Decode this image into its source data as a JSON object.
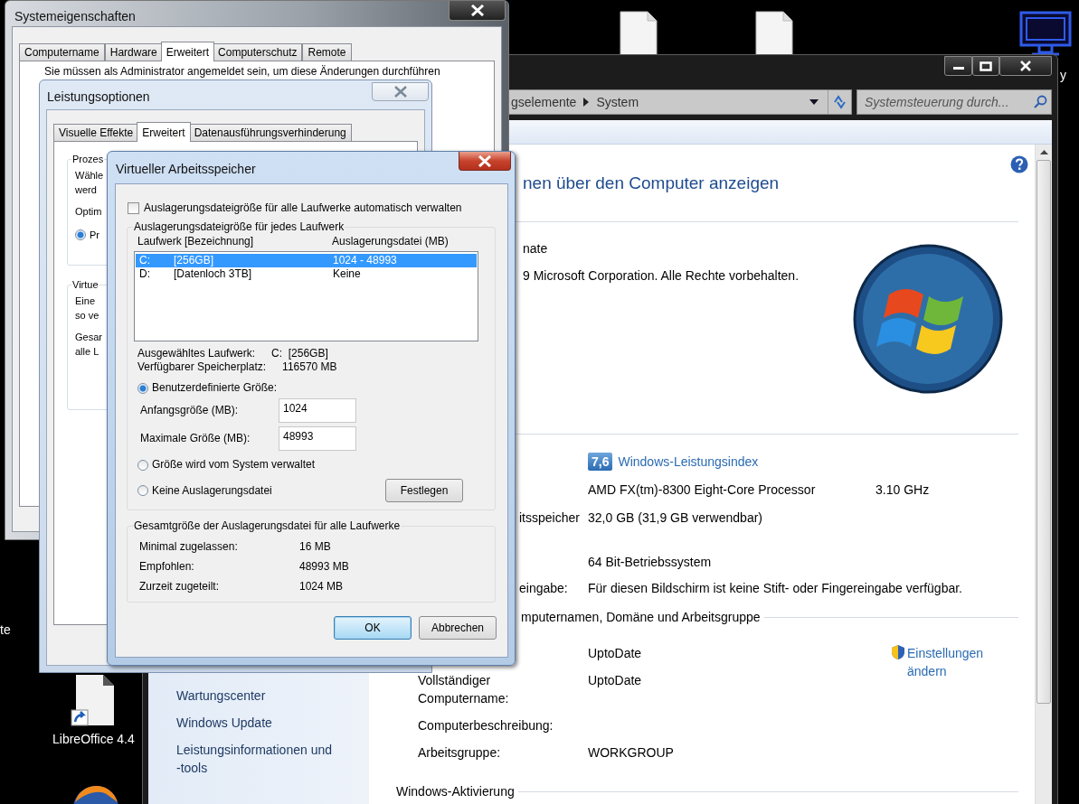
{
  "desktop": {
    "left_text": "te",
    "right_text": "y",
    "icons": [
      {
        "kind": "file"
      },
      {
        "kind": "file"
      },
      {
        "kind": "monitor"
      },
      {
        "kind": "shortcut",
        "label": "LibreOffice 4.4"
      },
      {
        "kind": "browser"
      }
    ]
  },
  "system_window": {
    "breadcrumb": [
      "gselemente",
      "System"
    ],
    "search": {
      "placeholder": "Systemsteuerung durch..."
    },
    "heading": "nen über den Computer anzeigen",
    "edition": "nate",
    "copyright": "9 Microsoft Corporation. Alle Rechte vorbehalten.",
    "rating": {
      "score": "7,6",
      "link": "Windows-Leistungsindex"
    },
    "system_rows": [
      {
        "value": "AMD FX(tm)-8300 Eight-Core Processor",
        "extra": "3.10 GHz"
      },
      {
        "label": "itsspeicher",
        "value": "32,0 GB (31,9 GB verwendbar)"
      },
      {
        "value": "64 Bit-Betriebssystem"
      },
      {
        "label": "eingabe:",
        "value": "Für diesen Bildschirm ist keine Stift- oder Fingereingabe verfügbar."
      }
    ],
    "computer_section": {
      "title": "mputernamen, Domäne und Arbeitsgruppe",
      "link": "Einstellungen ändern",
      "rows": [
        {
          "value": "UptoDate"
        },
        {
          "label": "Vollständiger Computername:",
          "value": "UptoDate"
        },
        {
          "label": "Computerbeschreibung:"
        },
        {
          "label": "Arbeitsgruppe:",
          "value": "WORKGROUP"
        }
      ]
    },
    "activation_title": "Windows-Aktivierung",
    "sidebar_links": [
      "Wartungscenter",
      "Windows Update",
      "Leistungsinformationen und -tools"
    ]
  },
  "system_properties": {
    "title": "Systemeigenschaften",
    "tabs": [
      {
        "label": "Computername",
        "selected": false
      },
      {
        "label": "Hardware",
        "selected": false
      },
      {
        "label": "Erweitert",
        "selected": true
      },
      {
        "label": "Computerschutz",
        "selected": false
      },
      {
        "label": "Remote",
        "selected": false
      }
    ],
    "notice": "Sie müssen als Administrator angemeldet sein, um diese Änderungen durchführen"
  },
  "performance_options": {
    "title": "Leistungsoptionen",
    "tabs": [
      {
        "label": "Visuelle Effekte",
        "selected": false
      },
      {
        "label": "Erweitert",
        "selected": true
      },
      {
        "label": "Datenausführungsverhinderung",
        "selected": false
      }
    ],
    "groups": [
      {
        "title": "Prozes",
        "paragraphs": [
          [
            "Wähle",
            "werd"
          ],
          [
            "Optim"
          ]
        ],
        "radio": {
          "label": "Pr",
          "selected": true
        }
      },
      {
        "title": "Virtue",
        "paragraphs": [
          [
            "Eine",
            "so ve"
          ],
          [
            "Gesar",
            "alle L"
          ]
        ]
      }
    ]
  },
  "virtual_memory": {
    "title": "Virtueller Arbeitsspeicher",
    "auto_manage": {
      "label": "Auslagerungsdateigröße für alle Laufwerke automatisch verwalten",
      "checked": false
    },
    "drives_group": "Auslagerungsdateigröße für jedes Laufwerk",
    "columns": [
      "Laufwerk [Bezeichnung]",
      "Auslagerungsdatei (MB)"
    ],
    "drives": [
      {
        "letter": "C:",
        "name": "[256GB]",
        "size": "1024 - 48993",
        "selected": true
      },
      {
        "letter": "D:",
        "name": "[Datenloch 3TB]",
        "size": "Keine",
        "selected": false
      }
    ],
    "info": [
      {
        "label": "Ausgewähltes Laufwerk:",
        "value": "C:  [256GB]"
      },
      {
        "label": "Verfügbarer Speicherplatz:",
        "value": "116570 MB"
      }
    ],
    "options": [
      {
        "label": "Benutzerdefinierte Größe:",
        "selected": true,
        "fields": [
          {
            "label": "Anfangsgröße (MB):",
            "value": "1024"
          },
          {
            "label": "Maximale Größe (MB):",
            "value": "48993"
          }
        ]
      },
      {
        "label": "Größe wird vom System verwaltet",
        "selected": false
      },
      {
        "label": "Keine Auslagerungsdatei",
        "selected": false
      }
    ],
    "set_button": "Festlegen",
    "totals_group": "Gesamtgröße der Auslagerungsdatei für alle Laufwerke",
    "totals": [
      {
        "label": "Minimal zugelassen:",
        "value": "16 MB"
      },
      {
        "label": "Empfohlen:",
        "value": "48993 MB"
      },
      {
        "label": "Zurzeit zugeteilt:",
        "value": "1024 MB"
      }
    ],
    "buttons": [
      {
        "label": "OK",
        "default": true
      },
      {
        "label": "Abbrechen",
        "default": false
      }
    ]
  }
}
